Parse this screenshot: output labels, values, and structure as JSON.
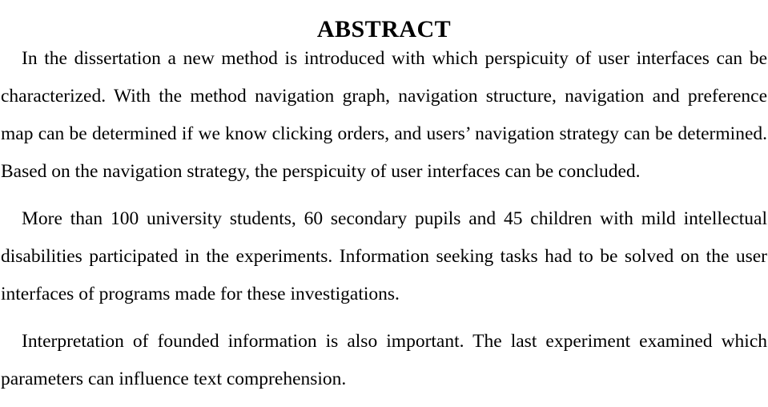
{
  "document": {
    "title": "ABSTRACT",
    "paragraphs": [
      {
        "id": "p1",
        "text": "In the dissertation a new method is introduced with which perspicuity of user interfaces can be characterized. With the method navigation graph, navigation structure, navigation and preference map can be determined if we know clicking orders, and users’ navigation strategy can be determined. Based on the navigation strategy, the perspicuity of user interfaces can be concluded."
      },
      {
        "id": "p2",
        "text": "More than 100 university students, 60 secondary pupils and 45 children with mild intellectual disabilities participated in the experiments. Information seeking tasks had to be solved on the user interfaces of programs made for these investigations."
      },
      {
        "id": "p3",
        "text": "Interpretation of founded information is also important. The last experiment examined which parameters can influence text comprehension."
      }
    ],
    "colors": {
      "text": "#000000",
      "background": "#ffffff"
    }
  }
}
